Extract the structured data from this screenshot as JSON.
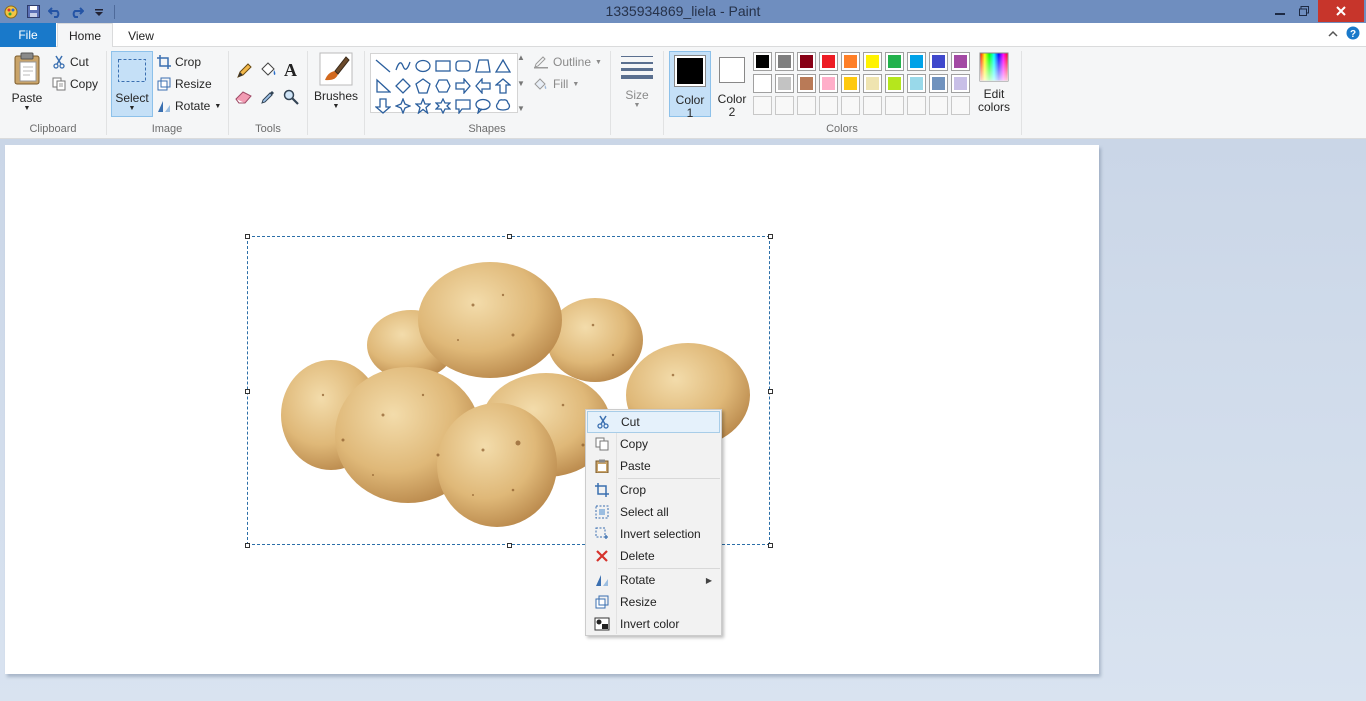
{
  "window": {
    "title": "1335934869_liela - Paint"
  },
  "tabs": {
    "file": "File",
    "home": "Home",
    "view": "View"
  },
  "clipboard": {
    "paste": "Paste",
    "cut": "Cut",
    "copy": "Copy",
    "label": "Clipboard"
  },
  "image": {
    "select": "Select",
    "crop": "Crop",
    "resize": "Resize",
    "rotate": "Rotate",
    "label": "Image"
  },
  "tools": {
    "label": "Tools"
  },
  "brushes": {
    "label": "Brushes"
  },
  "shapes": {
    "outline": "Outline",
    "fill": "Fill",
    "label": "Shapes"
  },
  "size": {
    "label": "Size"
  },
  "colors": {
    "color1_line1": "Color",
    "color1_line2": "1",
    "color2_line1": "Color",
    "color2_line2": "2",
    "edit_line1": "Edit",
    "edit_line2": "colors",
    "label": "Colors",
    "color1_value": "#000000",
    "color2_value": "#ffffff",
    "palette_row1": [
      "#000000",
      "#7f7f7f",
      "#880015",
      "#ed1c24",
      "#ff7f27",
      "#fff200",
      "#22b14c",
      "#00a2e8",
      "#3f48cc",
      "#a349a4"
    ],
    "palette_row2": [
      "#ffffff",
      "#c3c3c3",
      "#b97a57",
      "#ffaec9",
      "#ffc90e",
      "#efe4b0",
      "#b5e61d",
      "#99d9ea",
      "#7092be",
      "#c8bfe7"
    ]
  },
  "context_menu": {
    "cut": "Cut",
    "copy": "Copy",
    "paste": "Paste",
    "crop": "Crop",
    "select_all": "Select all",
    "invert_selection": "Invert selection",
    "delete": "Delete",
    "rotate": "Rotate",
    "resize": "Resize",
    "invert_color": "Invert color"
  }
}
